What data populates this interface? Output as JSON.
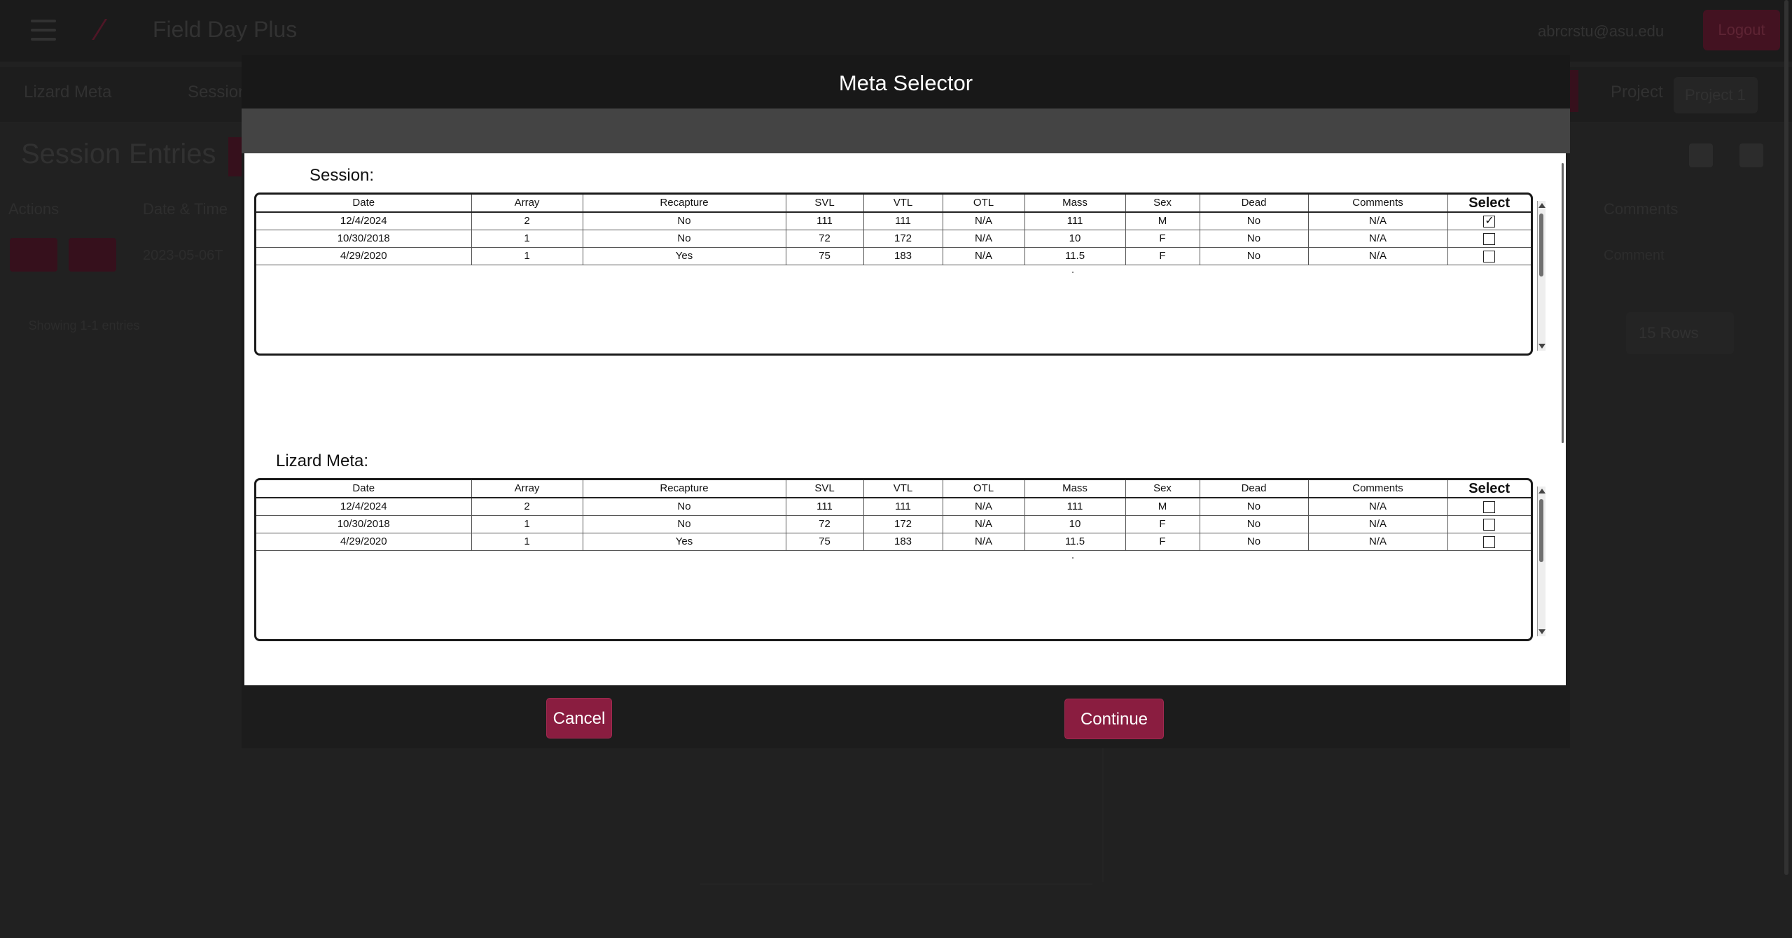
{
  "background_app": {
    "title": "Field Day Plus",
    "user_email": "abrcrstu@asu.edu",
    "logout_label": "Logout",
    "tabs": [
      "Lizard Meta",
      "Session"
    ],
    "project_label": "Project",
    "project_value": "Project 1",
    "page_tabs": [
      "Session",
      "Entries"
    ],
    "columns": [
      "Actions",
      "Date & Time",
      "Comments"
    ],
    "row_date": "2023-05-06T",
    "row_comment": "Comment",
    "side_text": "Showing 1-1 entries",
    "rows_per_page": "15 Rows"
  },
  "modal": {
    "title": "Meta Selector",
    "cancel_label": "Cancel",
    "continue_label": "Continue"
  },
  "columns": [
    "Date",
    "Array",
    "Recapture",
    "SVL",
    "VTL",
    "OTL",
    "Mass",
    "Sex",
    "Dead",
    "Comments",
    "Select"
  ],
  "session": {
    "label": "Session:",
    "rows": [
      {
        "date": "12/4/2024",
        "array": "2",
        "recapture": "No",
        "svl": "111",
        "vtl": "111",
        "otl": "N/A",
        "mass": "111",
        "sex": "M",
        "dead": "No",
        "comments": "N/A",
        "selected": true
      },
      {
        "date": "10/30/2018",
        "array": "1",
        "recapture": "No",
        "svl": "72",
        "vtl": "172",
        "otl": "N/A",
        "mass": "10",
        "sex": "F",
        "dead": "No",
        "comments": "N/A",
        "selected": false
      },
      {
        "date": "4/29/2020",
        "array": "1",
        "recapture": "Yes",
        "svl": "75",
        "vtl": "183",
        "otl": "N/A",
        "mass": "11.5",
        "sex": "F",
        "dead": "No",
        "comments": "N/A",
        "selected": false
      }
    ]
  },
  "lizard_meta": {
    "label": "Lizard Meta:",
    "rows": [
      {
        "date": "12/4/2024",
        "array": "2",
        "recapture": "No",
        "svl": "111",
        "vtl": "111",
        "otl": "N/A",
        "mass": "111",
        "sex": "M",
        "dead": "No",
        "comments": "N/A",
        "selected": false
      },
      {
        "date": "10/30/2018",
        "array": "1",
        "recapture": "No",
        "svl": "72",
        "vtl": "172",
        "otl": "N/A",
        "mass": "10",
        "sex": "F",
        "dead": "No",
        "comments": "N/A",
        "selected": false
      },
      {
        "date": "4/29/2020",
        "array": "1",
        "recapture": "Yes",
        "svl": "75",
        "vtl": "183",
        "otl": "N/A",
        "mass": "11.5",
        "sex": "F",
        "dead": "No",
        "comments": "N/A",
        "selected": false
      }
    ]
  },
  "colors": {
    "accent": "#8a1d40",
    "modal_header": "#181818",
    "modal_subbar": "#444444",
    "backdrop": "#262626"
  }
}
